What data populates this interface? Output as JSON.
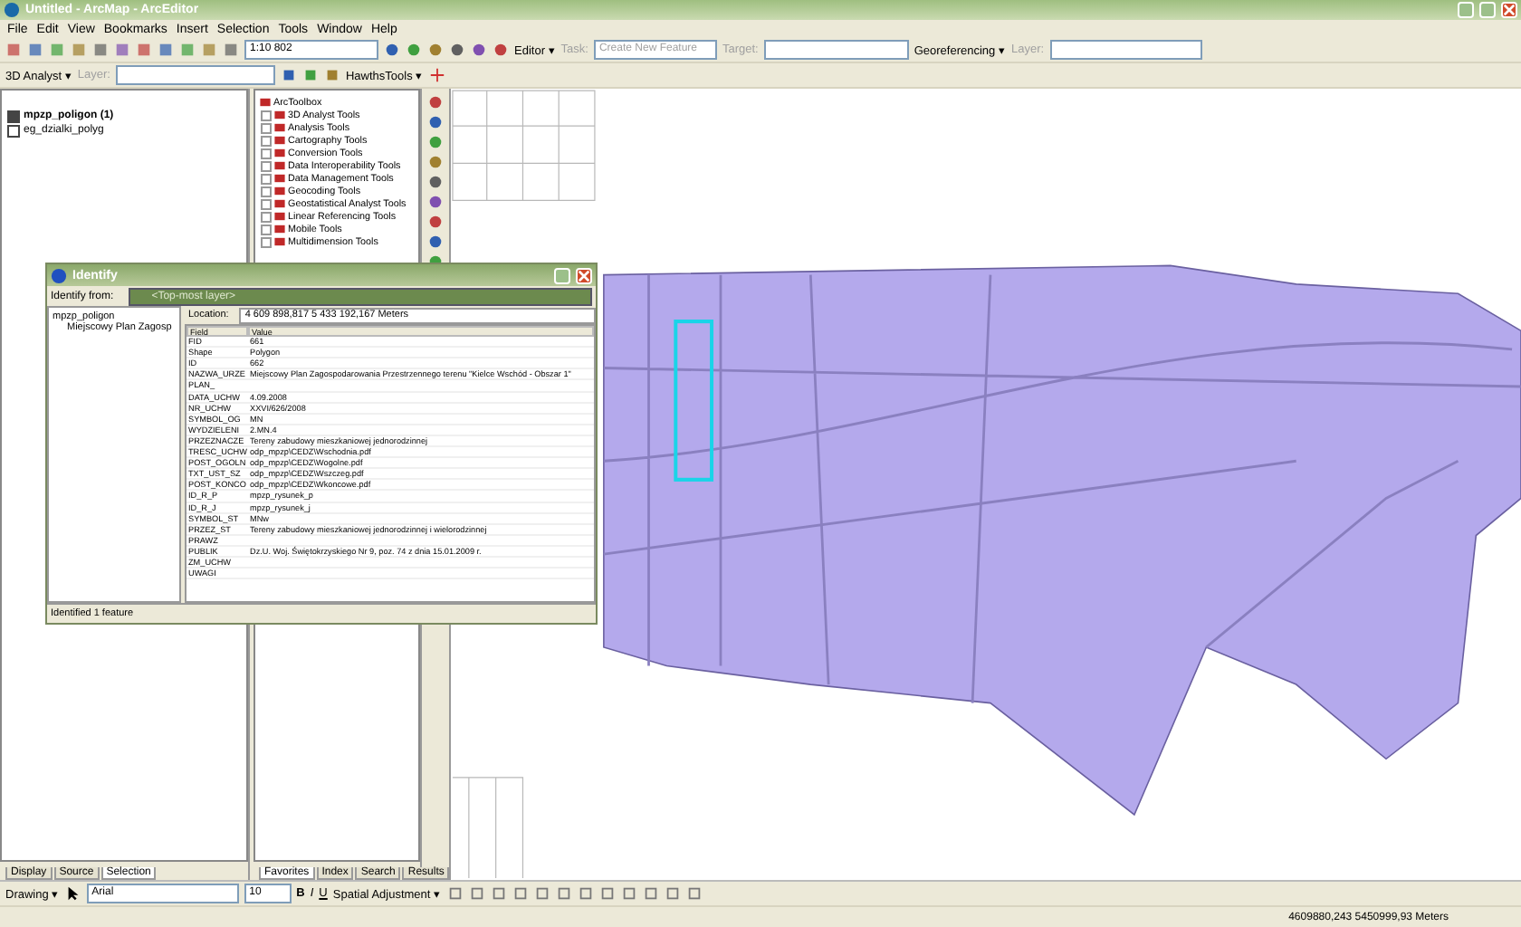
{
  "window": {
    "title": "Untitled - ArcMap - ArcEditor"
  },
  "menu": [
    "File",
    "Edit",
    "View",
    "Bookmarks",
    "Insert",
    "Selection",
    "Tools",
    "Window",
    "Help"
  ],
  "standard_toolbar": {
    "scale": "1:10 802",
    "editor": "Editor ▾",
    "task_label": "Task:",
    "task": "Create New Feature",
    "target_label": "Target:",
    "georeferencing": "Georeferencing ▾",
    "layer_label": "Layer:"
  },
  "analyst_toolbar": {
    "menu": "3D Analyst ▾",
    "layer_label": "Layer:",
    "hawths": "HawthsTools ▾"
  },
  "toc": {
    "layers": [
      {
        "name": "mpzp_poligon (1)",
        "checked": true
      },
      {
        "name": "eg_dzialki_polyg",
        "checked": false
      }
    ],
    "tabs": [
      {
        "label": "Display",
        "selected": false
      },
      {
        "label": "Source",
        "selected": false
      },
      {
        "label": "Selection",
        "selected": true
      }
    ]
  },
  "toolbox": {
    "root": "ArcToolbox",
    "items": [
      "3D Analyst Tools",
      "Analysis Tools",
      "Cartography Tools",
      "Conversion Tools",
      "Data Interoperability Tools",
      "Data Management Tools",
      "Geocoding Tools",
      "Geostatistical Analyst Tools",
      "Linear Referencing Tools",
      "Mobile Tools",
      "Multidimension Tools"
    ],
    "tabs": [
      {
        "label": "Favorites",
        "selected": true
      },
      {
        "label": "Index",
        "selected": false
      },
      {
        "label": "Search",
        "selected": false
      },
      {
        "label": "Results",
        "selected": false
      }
    ]
  },
  "identify": {
    "title": "Identify",
    "from_label": "Identify from:",
    "from_value": "<Top-most layer>",
    "layer": "mpzp_poligon",
    "feature": "Miejscowy Plan Zagosp",
    "location_label": "Location:",
    "location": "4 609 898,817  5 433 192,167 Meters",
    "columns": [
      "Field",
      "Value"
    ],
    "rows": [
      {
        "field": "FID",
        "value": "661"
      },
      {
        "field": "Shape",
        "value": "Polygon"
      },
      {
        "field": "ID",
        "value": "662"
      },
      {
        "field": "NAZWA_URZE",
        "value": "Miejscowy Plan Zagospodarowania Przestrzennego terenu \"Kielce Wschód - Obszar 1\""
      },
      {
        "field": "PLAN_"
      },
      {
        "field": "DATA_UCHW",
        "value": "4.09.2008"
      },
      {
        "field": "NR_UCHW",
        "value": "XXVI/626/2008"
      },
      {
        "field": "SYMBOL_OG",
        "value": "MN"
      },
      {
        "field": "WYDZIELENI",
        "value": "2.MN.4"
      },
      {
        "field": "PRZEZNACZE",
        "value": "Tereny zabudowy mieszkaniowej jednorodzinnej"
      },
      {
        "field": "TRESC_UCHW",
        "value": "odp_mpzp\\CEDZ\\Wschodnia.pdf"
      },
      {
        "field": "POST_OGOLN",
        "value": "odp_mpzp\\CEDZ\\Wogolne.pdf"
      },
      {
        "field": "TXT_UST_SZ",
        "value": "odp_mpzp\\CEDZ\\Wszczeg.pdf"
      },
      {
        "field": "POST_KONCO",
        "value": "odp_mpzp\\CEDZ\\Wkoncowe.pdf"
      },
      {
        "field": "ID_R_P",
        "value": "mpzp_rysunek_p"
      },
      {
        "field": "ID_R_J",
        "value": "mpzp_rysunek_j"
      },
      {
        "field": "SYMBOL_ST",
        "value": "MNw"
      },
      {
        "field": "PRZEZ_ST",
        "value": "Tereny zabudowy mieszkaniowej jednorodzinnej i wielorodzinnej"
      },
      {
        "field": "PRAWZ"
      },
      {
        "field": "PUBLIK",
        "value": "Dz.U. Woj. Świętokrzyskiego Nr 9, poz. 74 z dnia 15.01.2009 r."
      },
      {
        "field": "ZM_UCHW"
      },
      {
        "field": "UWAGI"
      }
    ],
    "status": "Identified 1 feature"
  },
  "drawing_toolbar": {
    "menu": "Drawing ▾",
    "font": "Arial",
    "size": "10",
    "bold": "B",
    "italic": "I",
    "underline": "U",
    "spatial": "Spatial Adjustment ▾"
  },
  "status_bar": {
    "coordinates": "4609880,243  5450999,93 Meters"
  }
}
